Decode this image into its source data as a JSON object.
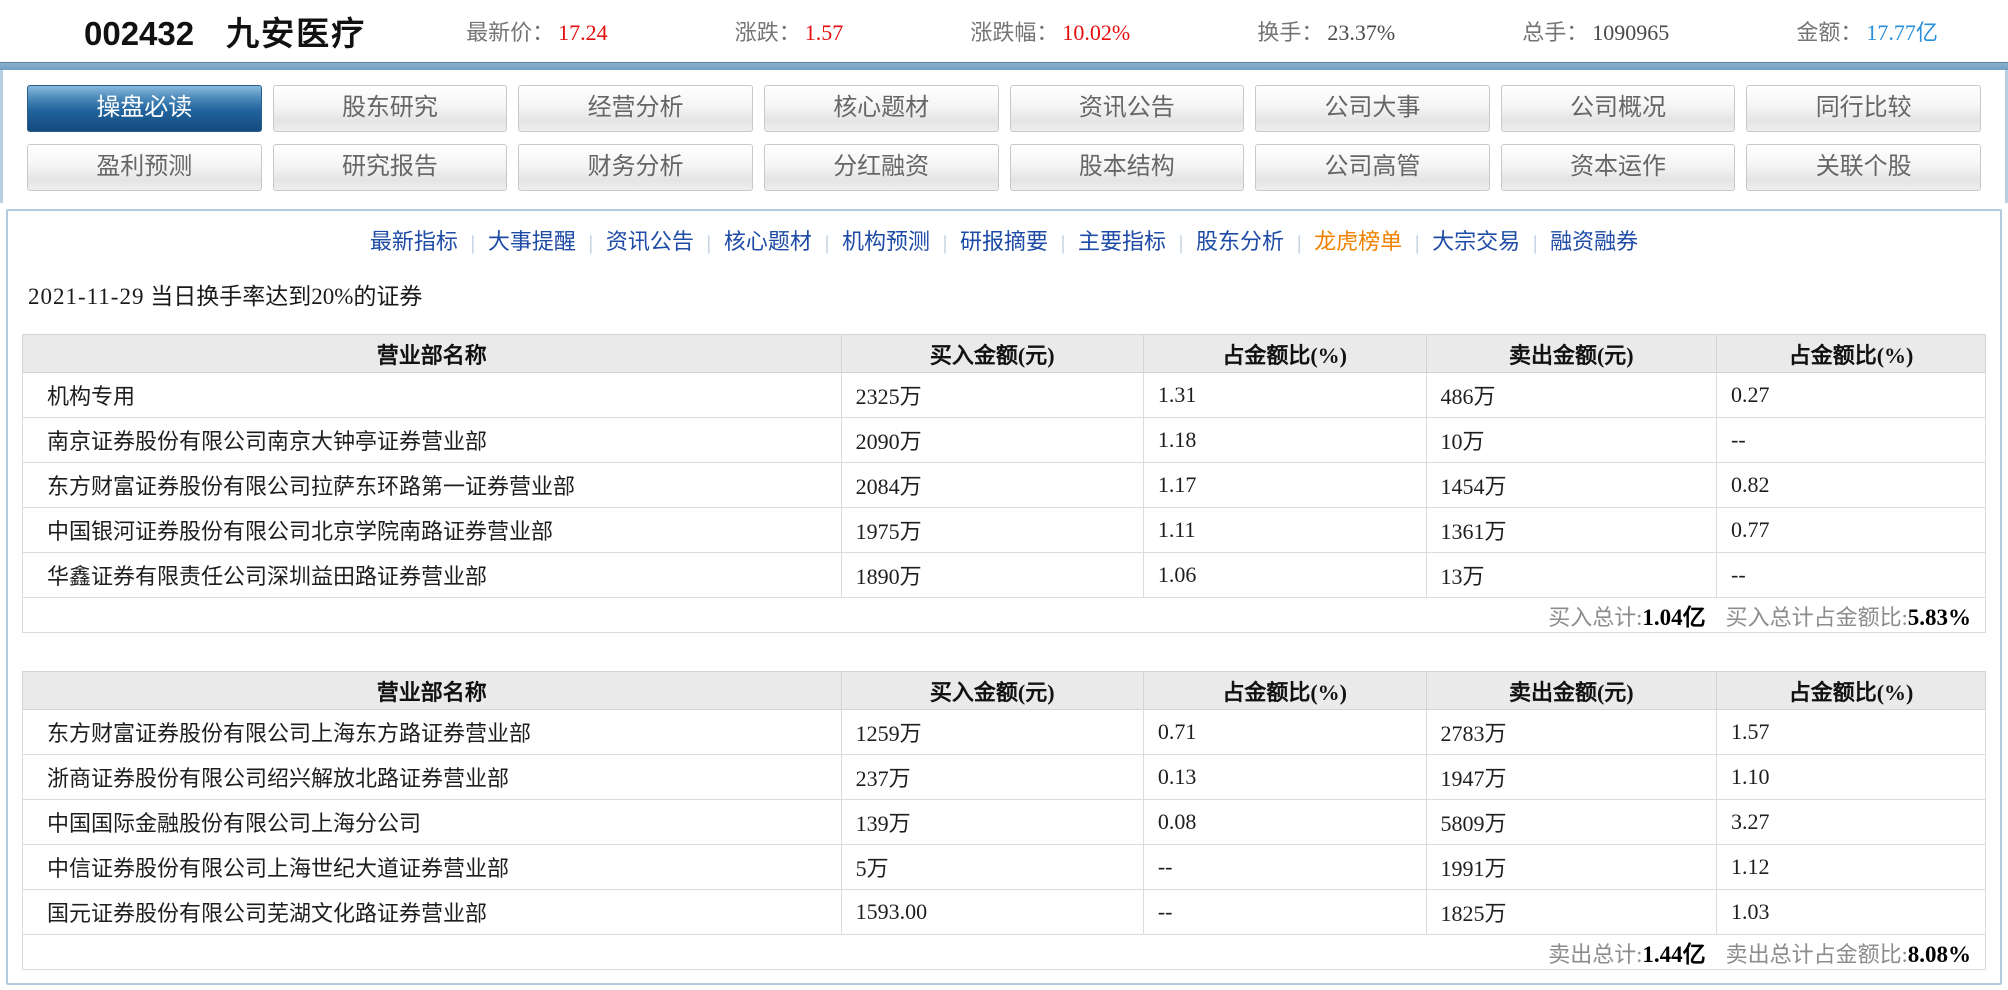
{
  "header": {
    "code": "002432",
    "name": "九安医疗",
    "stats": [
      {
        "label": "最新价：",
        "value": "17.24",
        "color": "red"
      },
      {
        "label": "涨跌：",
        "value": "1.57",
        "color": "red"
      },
      {
        "label": "涨跌幅：",
        "value": "10.02%",
        "color": "red"
      },
      {
        "label": "换手：",
        "value": "23.37%",
        "color": "dark"
      },
      {
        "label": "总手：",
        "value": "1090965",
        "color": "dark"
      },
      {
        "label": "金额：",
        "value": "17.77亿",
        "color": "blue"
      }
    ]
  },
  "tabs": {
    "row1": [
      {
        "label": "操盘必读",
        "active": true
      },
      {
        "label": "股东研究",
        "active": false
      },
      {
        "label": "经营分析",
        "active": false
      },
      {
        "label": "核心题材",
        "active": false
      },
      {
        "label": "资讯公告",
        "active": false
      },
      {
        "label": "公司大事",
        "active": false
      },
      {
        "label": "公司概况",
        "active": false
      },
      {
        "label": "同行比较",
        "active": false
      }
    ],
    "row2": [
      {
        "label": "盈利预测",
        "active": false
      },
      {
        "label": "研究报告",
        "active": false
      },
      {
        "label": "财务分析",
        "active": false
      },
      {
        "label": "分红融资",
        "active": false
      },
      {
        "label": "股本结构",
        "active": false
      },
      {
        "label": "公司高管",
        "active": false
      },
      {
        "label": "资本运作",
        "active": false
      },
      {
        "label": "关联个股",
        "active": false
      }
    ]
  },
  "subnav": {
    "separator": "|",
    "items": [
      {
        "label": "最新指标",
        "active": false
      },
      {
        "label": "大事提醒",
        "active": false
      },
      {
        "label": "资讯公告",
        "active": false
      },
      {
        "label": "核心题材",
        "active": false
      },
      {
        "label": "机构预测",
        "active": false
      },
      {
        "label": "研报摘要",
        "active": false
      },
      {
        "label": "主要指标",
        "active": false
      },
      {
        "label": "股东分析",
        "active": false
      },
      {
        "label": "龙虎榜单",
        "active": true
      },
      {
        "label": "大宗交易",
        "active": false
      },
      {
        "label": "融资融券",
        "active": false
      }
    ]
  },
  "section": {
    "date": "2021-11-29",
    "title": "当日换手率达到20%的证券"
  },
  "tables": [
    {
      "columns": [
        "营业部名称",
        "买入金额(元)",
        "占金额比(%)",
        "卖出金额(元)",
        "占金额比(%)"
      ],
      "rows": [
        [
          "机构专用",
          "2325万",
          "1.31",
          "486万",
          "0.27"
        ],
        [
          "南京证券股份有限公司南京大钟亭证券营业部",
          "2090万",
          "1.18",
          "10万",
          "--"
        ],
        [
          "东方财富证券股份有限公司拉萨东环路第一证券营业部",
          "2084万",
          "1.17",
          "1454万",
          "0.82"
        ],
        [
          "中国银河证券股份有限公司北京学院南路证券营业部",
          "1975万",
          "1.11",
          "1361万",
          "0.77"
        ],
        [
          "华鑫证券有限责任公司深圳益田路证券营业部",
          "1890万",
          "1.06",
          "13万",
          "--"
        ]
      ],
      "footer": [
        {
          "label": "买入总计:",
          "value": "1.04亿"
        },
        {
          "label": "买入总计占金额比:",
          "value": "5.83%"
        }
      ]
    },
    {
      "columns": [
        "营业部名称",
        "买入金额(元)",
        "占金额比(%)",
        "卖出金额(元)",
        "占金额比(%)"
      ],
      "rows": [
        [
          "东方财富证券股份有限公司上海东方路证券营业部",
          "1259万",
          "0.71",
          "2783万",
          "1.57"
        ],
        [
          "浙商证券股份有限公司绍兴解放北路证券营业部",
          "237万",
          "0.13",
          "1947万",
          "1.10"
        ],
        [
          "中国国际金融股份有限公司上海分公司",
          "139万",
          "0.08",
          "5809万",
          "3.27"
        ],
        [
          "中信证券股份有限公司上海世纪大道证券营业部",
          "5万",
          "--",
          "1991万",
          "1.12"
        ],
        [
          "国元证券股份有限公司芜湖文化路证券营业部",
          "1593.00",
          "--",
          "1825万",
          "1.03"
        ]
      ],
      "footer": [
        {
          "label": "卖出总计:",
          "value": "1.44亿"
        },
        {
          "label": "卖出总计占金额比:",
          "value": "8.08%"
        }
      ]
    }
  ],
  "colors": {
    "price_up_red": "#e60d0d",
    "amount_blue": "#2a8fd8",
    "link_navy": "#1d4ba6",
    "active_link_orange": "#f08200",
    "active_tab_blue": "#20639d",
    "divider_steel_blue": "#7ba6c6",
    "table_header_gray": "#eaeaea"
  }
}
